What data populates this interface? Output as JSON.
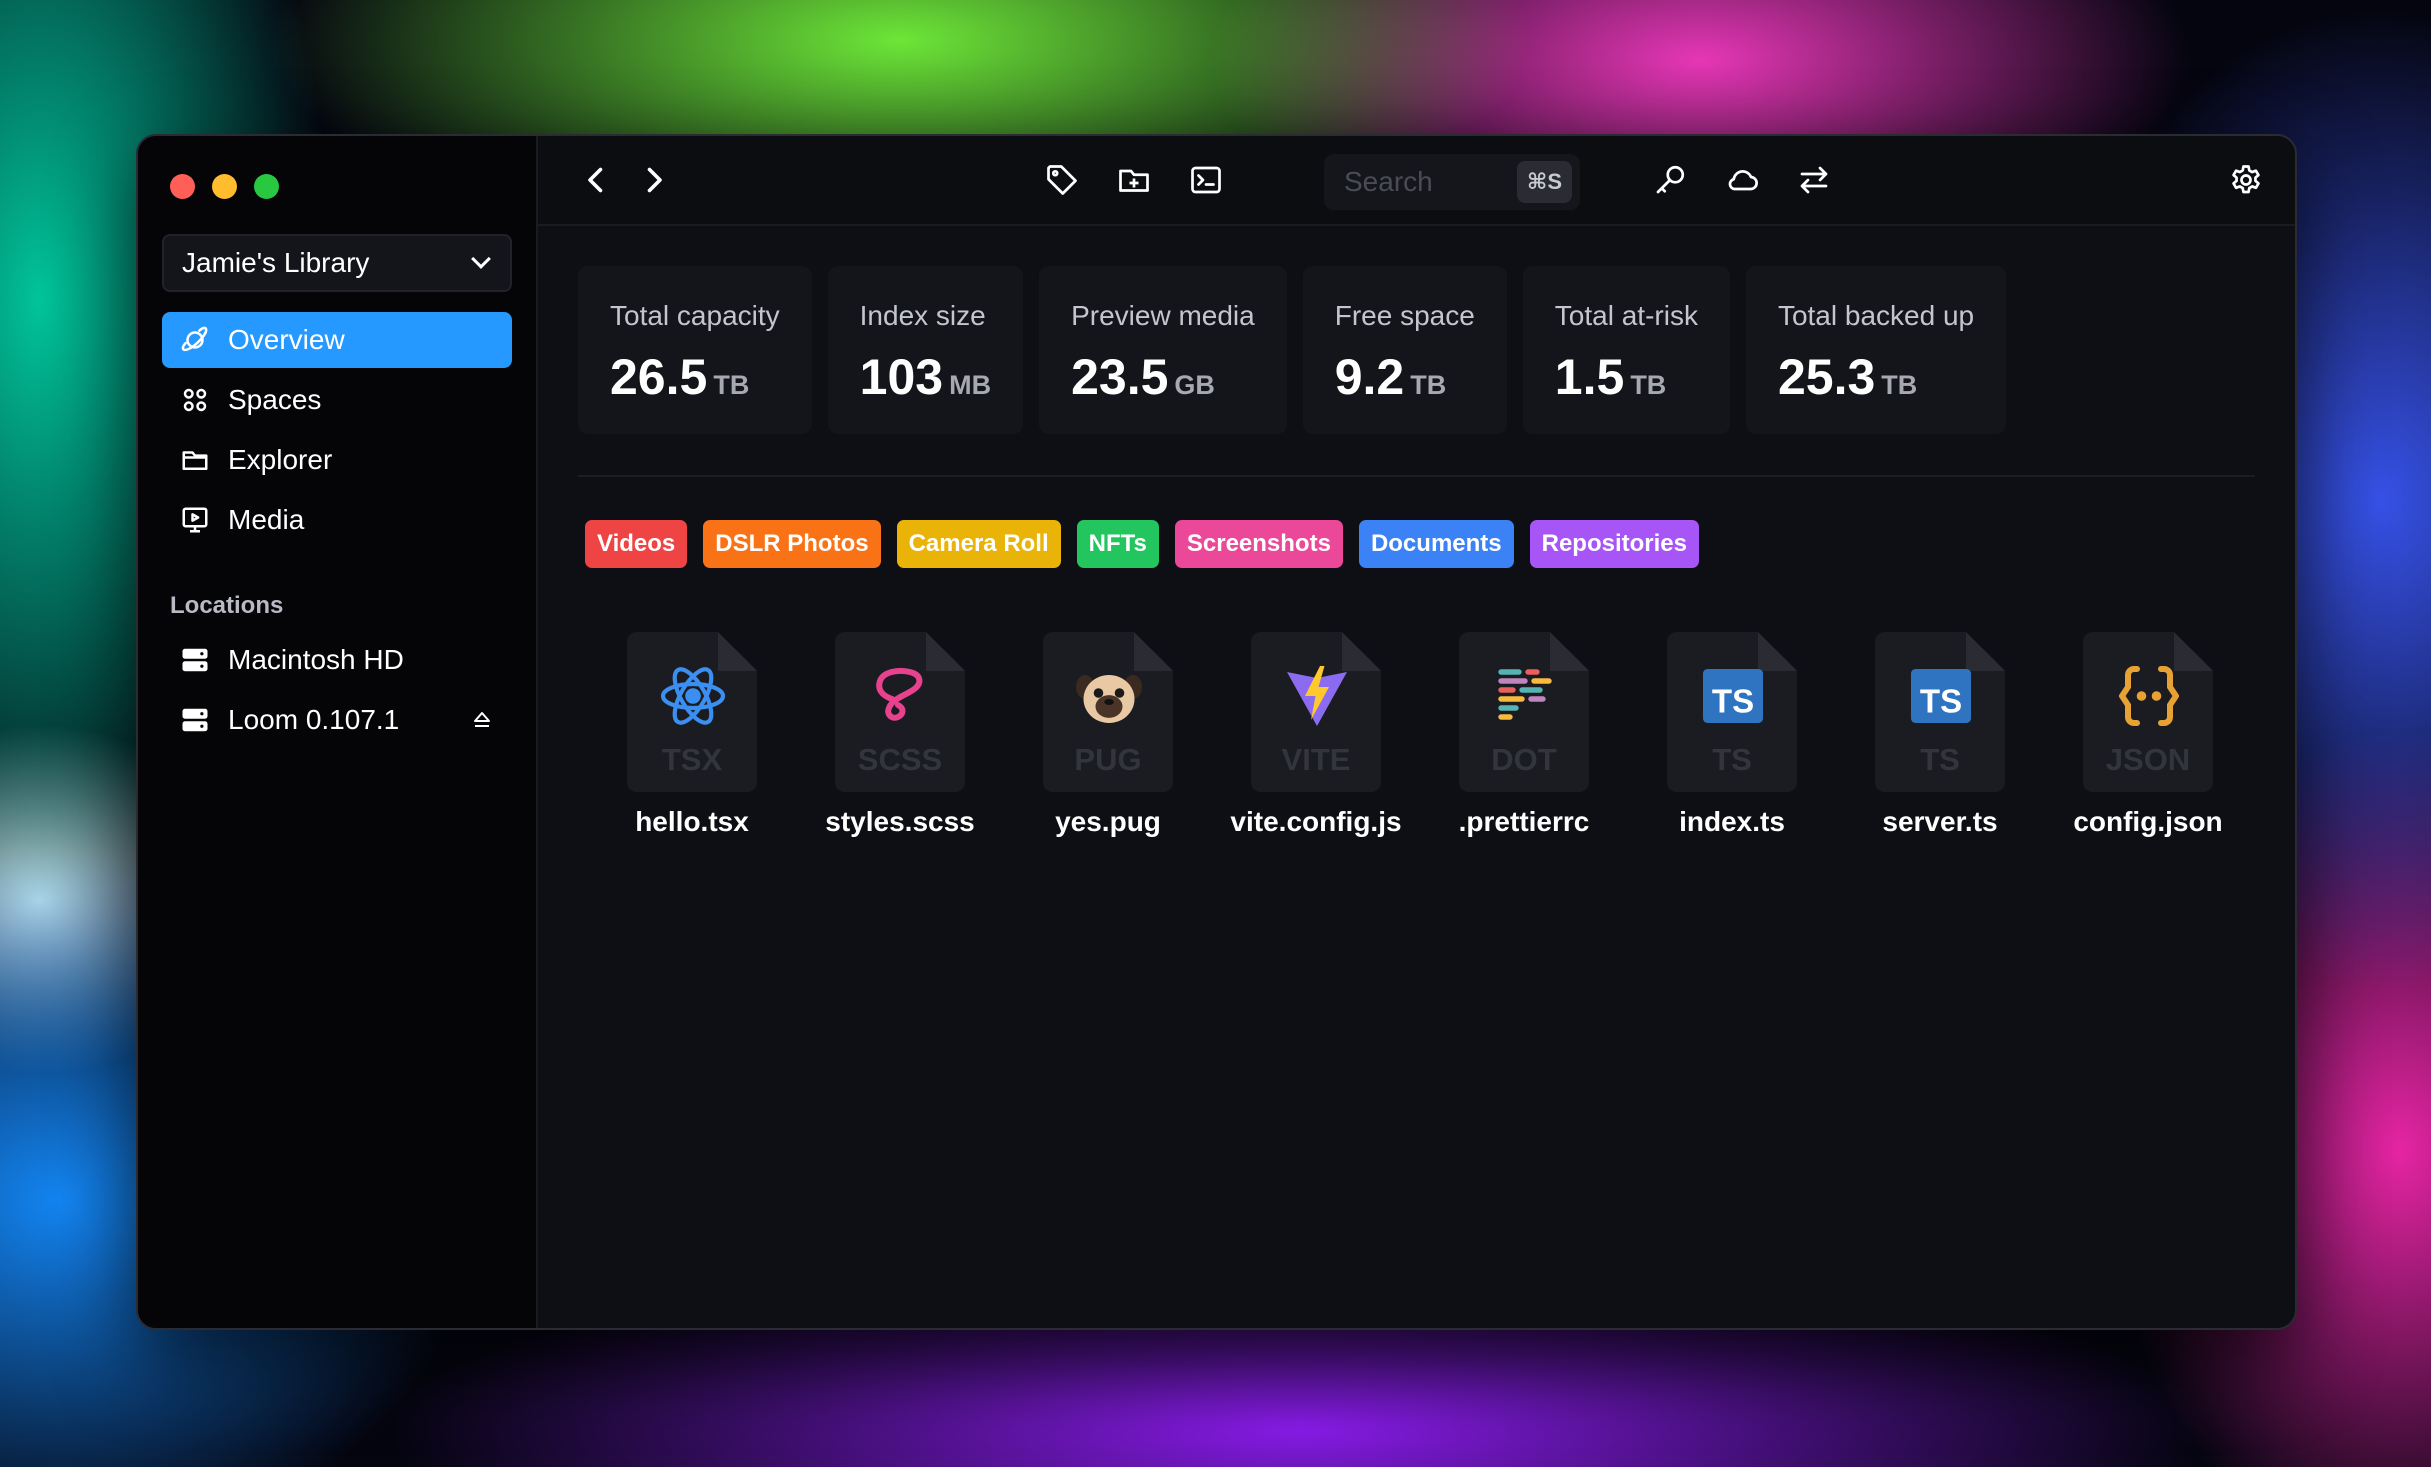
{
  "library": {
    "name": "Jamie's Library"
  },
  "nav": [
    {
      "label": "Overview",
      "icon": "planet-icon",
      "active": true
    },
    {
      "label": "Spaces",
      "icon": "grid-icon"
    },
    {
      "label": "Explorer",
      "icon": "folder-icon"
    },
    {
      "label": "Media",
      "icon": "media-icon"
    }
  ],
  "locations": {
    "title": "Locations",
    "items": [
      {
        "label": "Macintosh HD",
        "icon": "drive-icon"
      },
      {
        "label": "Loom 0.107.1",
        "icon": "drive-icon",
        "eject": true
      }
    ]
  },
  "toolbar": {
    "search_placeholder": "Search",
    "search_shortcut": "⌘S",
    "icons": [
      "back-icon",
      "forward-icon",
      "tag-icon",
      "new-folder-icon",
      "terminal-icon",
      "key-icon",
      "cloud-icon",
      "sync-icon",
      "settings-icon"
    ]
  },
  "stats": [
    {
      "label": "Total capacity",
      "value": "26.5",
      "unit": "TB"
    },
    {
      "label": "Index size",
      "value": "103",
      "unit": "MB"
    },
    {
      "label": "Preview media",
      "value": "23.5",
      "unit": "GB"
    },
    {
      "label": "Free space",
      "value": "9.2",
      "unit": "TB"
    },
    {
      "label": "Total at-risk",
      "value": "1.5",
      "unit": "TB"
    },
    {
      "label": "Total backed up",
      "value": "25.3",
      "unit": "TB"
    }
  ],
  "tags": [
    {
      "label": "Videos",
      "color": "#ef4444"
    },
    {
      "label": "DSLR Photos",
      "color": "#f97316"
    },
    {
      "label": "Camera Roll",
      "color": "#eab308"
    },
    {
      "label": "NFTs",
      "color": "#22c55e"
    },
    {
      "label": "Screenshots",
      "color": "#ec4899"
    },
    {
      "label": "Documents",
      "color": "#3b82f6"
    },
    {
      "label": "Repositories",
      "color": "#a855f7"
    }
  ],
  "files": [
    {
      "name": "hello.tsx",
      "ext": "TSX",
      "icon": "react-icon"
    },
    {
      "name": "styles.scss",
      "ext": "SCSS",
      "icon": "sass-icon"
    },
    {
      "name": "yes.pug",
      "ext": "PUG",
      "icon": "pug-icon"
    },
    {
      "name": "vite.config.js",
      "ext": "VITE",
      "icon": "vite-icon"
    },
    {
      "name": ".prettierrc",
      "ext": "DOT",
      "icon": "prettier-icon"
    },
    {
      "name": "index.ts",
      "ext": "TS",
      "icon": "typescript-icon"
    },
    {
      "name": "server.ts",
      "ext": "TS",
      "icon": "typescript-icon"
    },
    {
      "name": "config.json",
      "ext": "JSON",
      "icon": "json-icon"
    }
  ],
  "colors": {
    "accent": "#2599ff",
    "window_bg": "#0e0f14",
    "sidebar_bg": "#050507",
    "traffic_red": "#ff5f57",
    "traffic_yellow": "#febc2e",
    "traffic_green": "#28c840"
  }
}
